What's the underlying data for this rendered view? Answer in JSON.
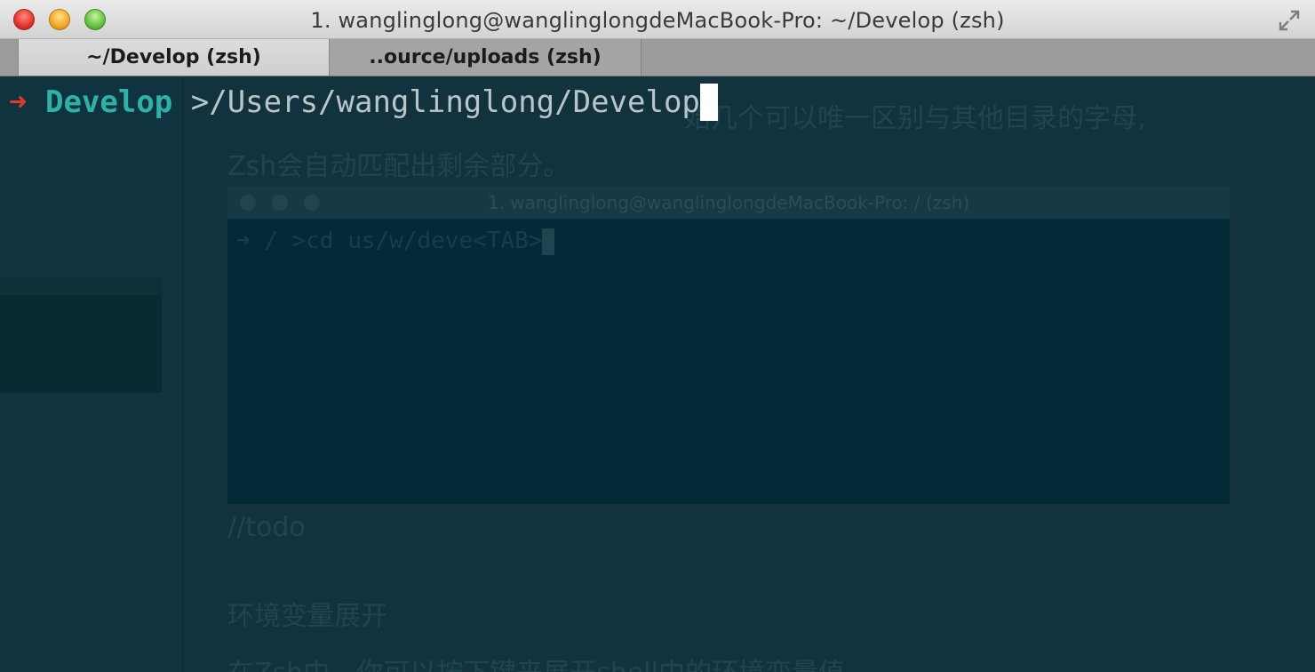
{
  "window": {
    "title": "1. wanglinglong@wanglinglongdeMacBook-Pro: ~/Develop (zsh)"
  },
  "tabs": [
    {
      "label": "~/Develop (zsh)",
      "active": true
    },
    {
      "label": "..ource/uploads (zsh)",
      "active": false
    }
  ],
  "terminal": {
    "prompt_arrow": "➜",
    "prompt_dir": "Develop",
    "prompt_path": ">/Users/wanglinglong/Develop",
    "colors": {
      "background": "#0f3440",
      "arrow": "#e0372f",
      "dir": "#2fb1a8",
      "path": "#b9c6c9",
      "cursor": "#ffffff"
    }
  },
  "background_page": {
    "line1": "始几个可以唯一区别与其他目录的字母,",
    "line2": "Zsh会自动匹配出剩余部分。",
    "inner_window_title": "1. wanglinglong@wanglinglongdeMacBook-Pro: / (zsh)",
    "inner_command": "➜ / >cd us/w/deve<TAB>",
    "todo": "//todo",
    "heading": "环境变量展开",
    "paragraph": "在Zsh中，你可以按下键来展开shell中的环境变量值"
  }
}
